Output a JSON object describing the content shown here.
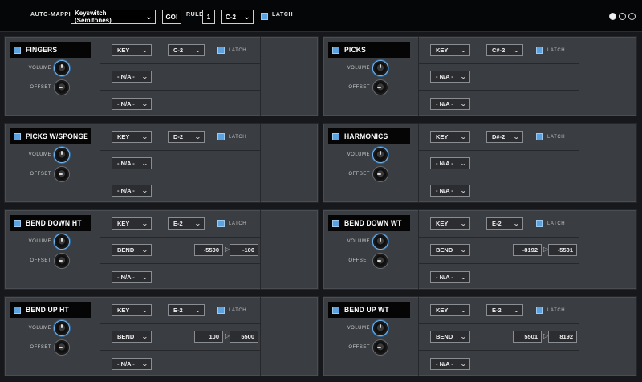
{
  "topbar": {
    "auto_mapping_label": "AUTO-MAPPING",
    "mapping_mode": "Keyswitch (Semitones)",
    "go_label": "GO!",
    "rule_label": "RULE",
    "rule_value": "1",
    "key_value": "C-2",
    "latch_label": "LATCH",
    "latch_checked": true
  },
  "labels": {
    "volume": "VOLUME",
    "offset": "OFFSET",
    "latch": "LATCH"
  },
  "colors": {
    "accent": "#5aa2e0",
    "panel": "#3a3d42",
    "background": "#16181b"
  },
  "pages": {
    "count": 3,
    "current": 1
  },
  "panels": [
    {
      "title": "FINGERS",
      "trigger": "KEY",
      "key": "C-2",
      "row2": "- N/A -",
      "row3": "- N/A -"
    },
    {
      "title": "PICKS",
      "trigger": "KEY",
      "key": "C#-2",
      "row2": "- N/A -",
      "row3": "- N/A -"
    },
    {
      "title": "PICKS W/SPONGE",
      "trigger": "KEY",
      "key": "D-2",
      "row2": "- N/A -",
      "row3": "- N/A -"
    },
    {
      "title": "HARMONICS",
      "trigger": "KEY",
      "key": "D#-2",
      "row2": "- N/A -",
      "row3": "- N/A -"
    },
    {
      "title": "BEND DOWN HT",
      "trigger": "KEY",
      "key": "E-2",
      "row2": "BEND",
      "range_from": "-5500",
      "range_to": "-100",
      "row3": "- N/A -"
    },
    {
      "title": "BEND DOWN WT",
      "trigger": "KEY",
      "key": "E-2",
      "row2": "BEND",
      "range_from": "-8192",
      "range_to": "-5501",
      "row3": "- N/A -"
    },
    {
      "title": "BEND UP HT",
      "trigger": "KEY",
      "key": "E-2",
      "row2": "BEND",
      "range_from": "100",
      "range_to": "5500",
      "row3": "- N/A -"
    },
    {
      "title": "BEND UP WT",
      "trigger": "KEY",
      "key": "E-2",
      "row2": "BEND",
      "range_from": "5501",
      "range_to": "8192",
      "row3": "- N/A -"
    }
  ]
}
